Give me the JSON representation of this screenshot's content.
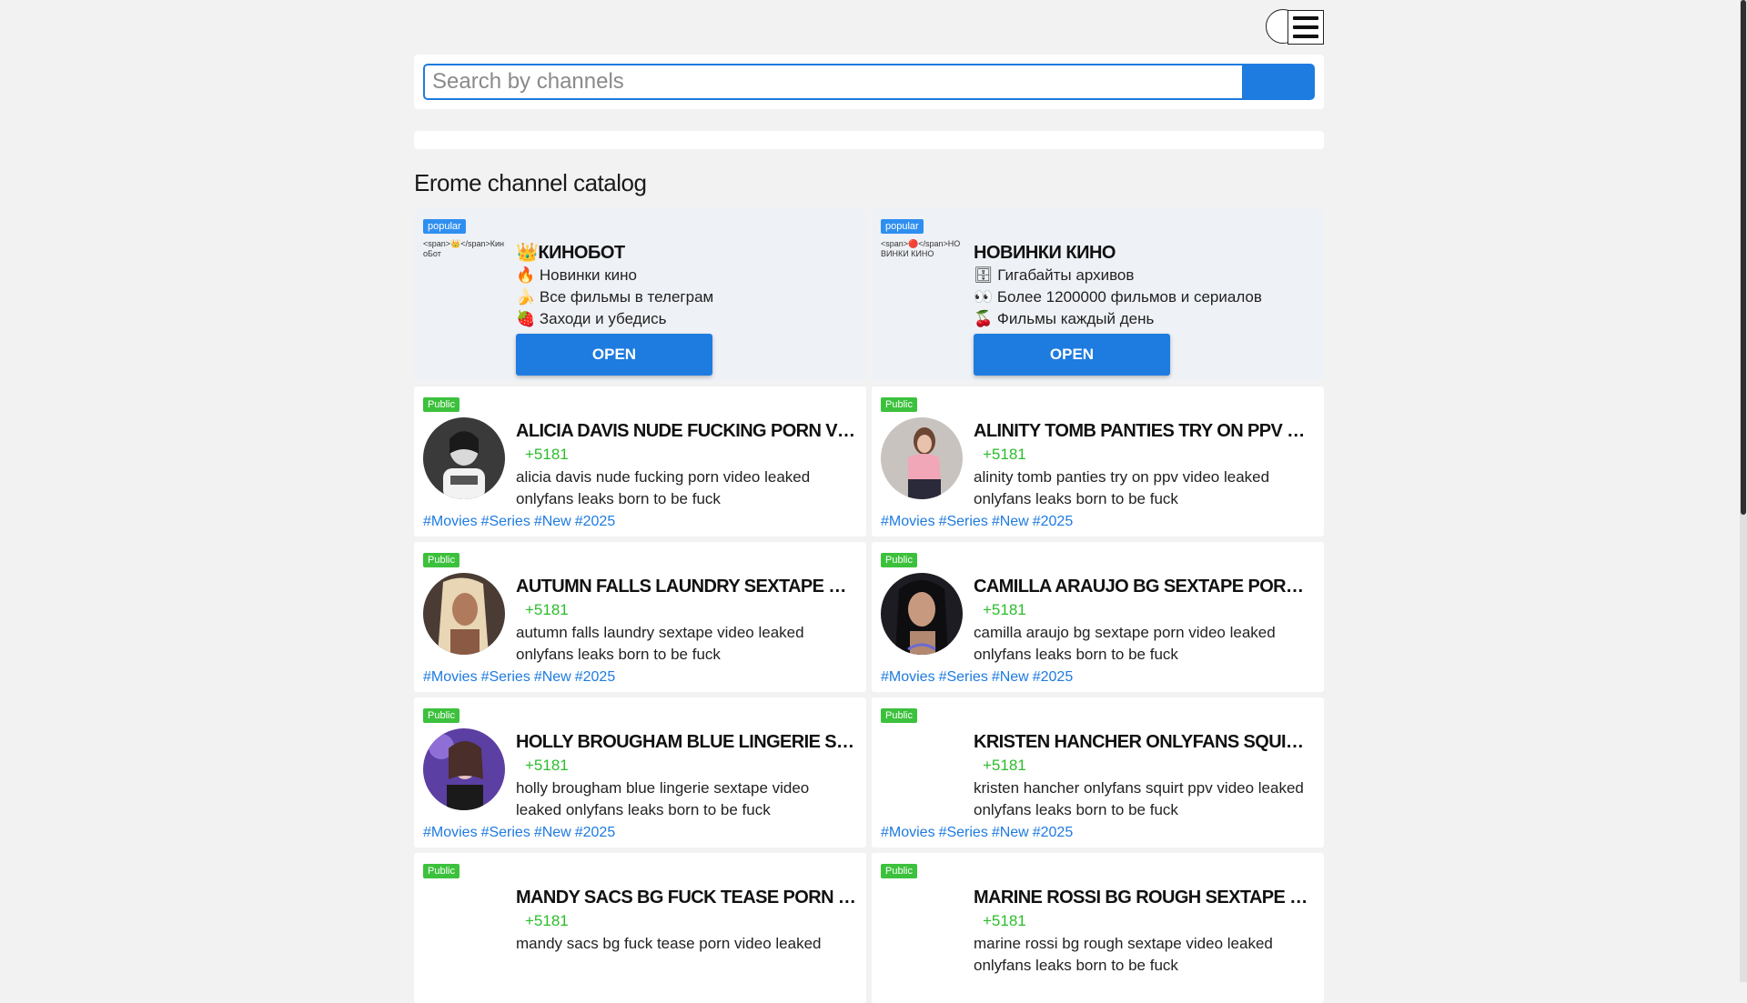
{
  "search": {
    "placeholder": "Search by channels"
  },
  "catalog_title": "Erome channel catalog",
  "ads": [
    {
      "badge": "popular",
      "avatar_alt": "<span>👑</span>КиноБот",
      "title": "👑КИНОБОТ",
      "lines": [
        "🔥 Новинки кино",
        "🍌 Все фильмы в телеграм",
        "🍓 Заходи и убедись"
      ],
      "button": "OPEN"
    },
    {
      "badge": "popular",
      "avatar_alt": "<span>🔴</span>НОВИНКИ КИНО",
      "title": "НОВИНКИ КИНО",
      "lines": [
        "🗄 Гигабайты архивов",
        "👀 Более 1200000 фильмов и сериалов",
        "🍒 Фильмы каждый день"
      ],
      "button": "OPEN"
    }
  ],
  "channels": [
    {
      "badge": "Public",
      "title": "ALICIA DAVIS NUDE FUCKING PORN VIDEO LEAKED",
      "subs": "+5181",
      "desc": "alicia davis nude fucking porn video leaked onlyfans leaks born to be fuck",
      "avatar": "bw"
    },
    {
      "badge": "Public",
      "title": "ALINITY TOMB PANTIES TRY ON PPV VIDEO LEAKED",
      "subs": "+5181",
      "desc": "alinity tomb panties try on ppv video leaked onlyfans leaks born to be fuck",
      "avatar": "pink"
    },
    {
      "badge": "Public",
      "title": "AUTUMN FALLS LAUNDRY SEXTAPE VIDEO LEAKED",
      "subs": "+5181",
      "desc": "autumn falls laundry sextape video leaked onlyfans leaks born to be fuck",
      "avatar": "blonde"
    },
    {
      "badge": "Public",
      "title": "CAMILLA ARAUJO BG SEXTAPE PORN VIDEO LEAKED",
      "subs": "+5181",
      "desc": "camilla araujo bg sextape porn video leaked onlyfans leaks born to be fuck",
      "avatar": "dark"
    },
    {
      "badge": "Public",
      "title": "HOLLY BROUGHAM BLUE LINGERIE SEXTAPE VIDEO LEAKED",
      "subs": "+5181",
      "desc": "holly brougham blue lingerie sextape video leaked onlyfans leaks born to be fuck",
      "avatar": "purple"
    },
    {
      "badge": "Public",
      "title": "KRISTEN HANCHER ONLYFANS SQUIRT PPV VIDEO LEAKED",
      "subs": "+5181",
      "desc": "kristen hancher onlyfans squirt ppv video leaked onlyfans leaks born to be fuck",
      "avatar": "none"
    },
    {
      "badge": "Public",
      "title": "MANDY SACS BG FUCK TEASE PORN VIDEO LEAKED",
      "subs": "+5181",
      "desc": "mandy sacs bg fuck tease porn video leaked",
      "avatar": "none"
    },
    {
      "badge": "Public",
      "title": "MARINE ROSSI BG ROUGH SEXTAPE VIDEO LEAKED",
      "subs": "+5181",
      "desc": "marine rossi bg rough sextape video leaked onlyfans leaks born to be fuck",
      "avatar": "none"
    }
  ],
  "tags": [
    "#Movies",
    "#Series",
    "#New",
    "#2025"
  ],
  "icons": {
    "theme": "theme-toggle-icon",
    "menu": "hamburger-menu-icon",
    "search": "search-icon"
  },
  "colors": {
    "accent": "#1e7be0",
    "popular_badge": "#2e8ff0",
    "public_badge": "#3cc13c",
    "subs": "#2bbd2b"
  }
}
